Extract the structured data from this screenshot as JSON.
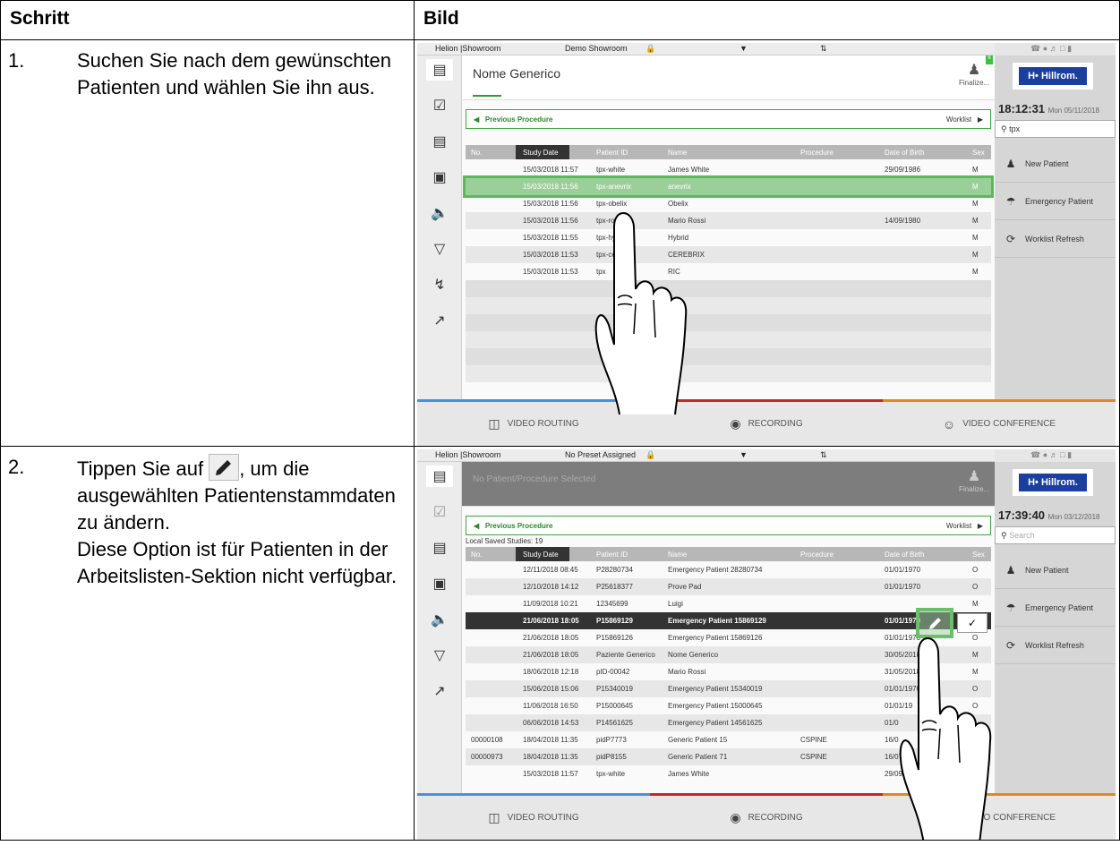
{
  "table": {
    "col_step": "Schritt",
    "col_image": "Bild"
  },
  "steps": [
    {
      "number": "1.",
      "text": "Suchen Sie nach dem gewünschten Patienten und wählen Sie ihn aus."
    },
    {
      "number": "2.",
      "text_before": "Tippen Sie auf",
      "text_after": ", um die ausgewählten Patientenstammdaten zu ändern.",
      "note": "Diese Option ist für Patienten in der Arbeitslisten-Sektion nicht verfügbar.",
      "inline_icon": "pencil-icon"
    }
  ],
  "screen1": {
    "app": "Helion |Showroom",
    "room": "Demo Showroom",
    "patient_name": "Nome Generico",
    "finalize": "Finalize...",
    "badge": "6",
    "logo": "Hillrom.",
    "time": "18:12:31",
    "date": "Mon 05/11/2018",
    "search_value": "tpx",
    "prev_procedure": "Previous Procedure",
    "worklist": "Worklist",
    "headers": [
      "No.",
      "Study Date",
      "Patient ID",
      "Name",
      "Procedure",
      "Date of Birth",
      "Sex"
    ],
    "rows": [
      [
        "",
        "15/03/2018 11:57",
        "tpx-white",
        "James White",
        "",
        "29/09/1986",
        "M"
      ],
      [
        "",
        "15/03/2018 11:56",
        "tpx-anevrix",
        "anevrix",
        "",
        "",
        "M"
      ],
      [
        "",
        "15/03/2018 11:56",
        "tpx-obelix",
        "Obelix",
        "",
        "",
        "M"
      ],
      [
        "",
        "15/03/2018 11:56",
        "tpx-rossi",
        "Mario Rossi",
        "",
        "14/09/1980",
        "M"
      ],
      [
        "",
        "15/03/2018 11:55",
        "tpx-hybrid",
        "Hybrid",
        "",
        "",
        "M"
      ],
      [
        "",
        "15/03/2018 11:53",
        "tpx-cere",
        "CEREBRIX",
        "",
        "",
        "M"
      ],
      [
        "",
        "15/03/2018 11:53",
        "tpx",
        "RIC",
        "",
        "",
        "M"
      ]
    ],
    "side_buttons": [
      "New Patient",
      "Emergency Patient",
      "Worklist Refresh"
    ],
    "bottom": [
      "VIDEO ROUTING",
      "RECORDING",
      "VIDEO CONFERENCE"
    ]
  },
  "screen2": {
    "app": "Helion |Showroom",
    "room": "No Preset Assigned",
    "patient_name": "No Patient/Procedure Selected",
    "finalize": "Finalize...",
    "logo": "Hillrom.",
    "time": "17:39:40",
    "date": "Mon 03/12/2018",
    "search_placeholder": "Search",
    "prev_procedure": "Previous Procedure",
    "worklist": "Worklist",
    "saved": "Local Saved Studies: 19",
    "headers": [
      "No.",
      "Study Date",
      "Patient ID",
      "Name",
      "Procedure",
      "Date of Birth",
      "Sex"
    ],
    "rows": [
      [
        "",
        "12/11/2018 08:45",
        "P28280734",
        "Emergency Patient 28280734",
        "",
        "01/01/1970",
        "O"
      ],
      [
        "",
        "12/10/2018 14:12",
        "P25618377",
        "Prove Pad",
        "",
        "01/01/1970",
        "O"
      ],
      [
        "",
        "11/09/2018 10:21",
        "12345699",
        "Luigi",
        "",
        "",
        "M"
      ],
      [
        "",
        "21/06/2018 18:05",
        "P15869129",
        "Emergency Patient 15869129",
        "",
        "01/01/1970",
        ""
      ],
      [
        "",
        "21/06/2018 18:05",
        "P15869126",
        "Emergency Patient 15869126",
        "",
        "01/01/1970",
        "O"
      ],
      [
        "",
        "21/06/2018 18:05",
        "Paziente Generico",
        "Nome Generico",
        "",
        "30/05/2018",
        "M"
      ],
      [
        "",
        "18/06/2018 12:18",
        "pID-00042",
        "Mario Rossi",
        "",
        "31/05/2018",
        "M"
      ],
      [
        "",
        "15/06/2018 15:06",
        "P15340019",
        "Emergency Patient 15340019",
        "",
        "01/01/1970",
        "O"
      ],
      [
        "",
        "11/06/2018 16:50",
        "P15000645",
        "Emergency Patient 15000645",
        "",
        "01/01/19",
        "O"
      ],
      [
        "",
        "06/06/2018 14:53",
        "P14561625",
        "Emergency Patient 14561625",
        "",
        "01/0",
        ""
      ],
      [
        "00000108",
        "18/04/2018 11:35",
        "pidP7773",
        "Generic Patient 15",
        "CSPINE",
        "16/0",
        ""
      ],
      [
        "00000973",
        "18/04/2018 11:35",
        "pidP8155",
        "Generic Patient 71",
        "CSPINE",
        "16/07",
        ""
      ],
      [
        "",
        "15/03/2018 11:57",
        "tpx-white",
        "James White",
        "",
        "29/09/19",
        "M"
      ]
    ],
    "check": "✓",
    "side_buttons": [
      "New Patient",
      "Emergency Patient",
      "Worklist Refresh"
    ],
    "bottom": [
      "VIDEO ROUTING",
      "RECORDING",
      "VIDEO CONFERENCE"
    ]
  },
  "colors": {
    "accent_green": "#3fa63f",
    "brand_blue": "#1b3f9e",
    "routing_blue": "#4a90d9",
    "recording_red": "#c62828",
    "conference_orange": "#e08a1e"
  }
}
